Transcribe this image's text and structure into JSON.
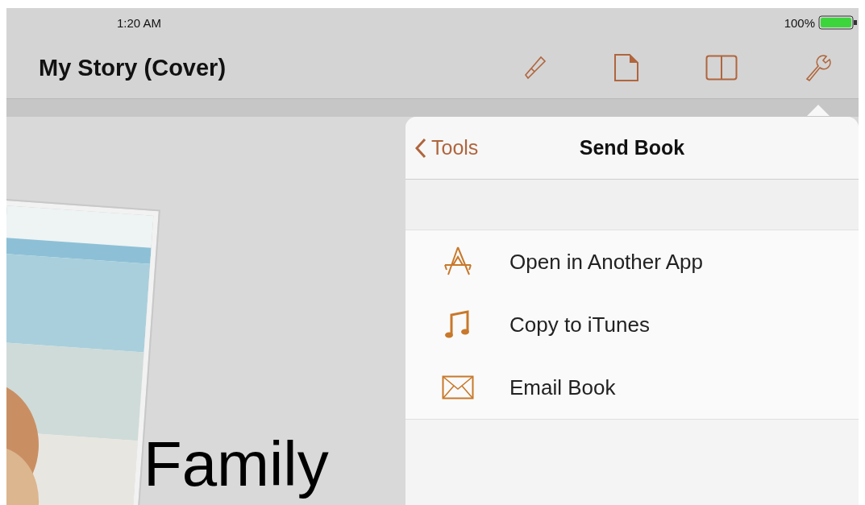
{
  "status_bar": {
    "time": "1:20 AM",
    "battery_percent": "100%"
  },
  "toolbar": {
    "title": "My Story (Cover)",
    "tools": [
      {
        "kind": "pen"
      },
      {
        "kind": "page"
      },
      {
        "kind": "book"
      },
      {
        "kind": "wrench",
        "selected": true
      }
    ]
  },
  "page": {
    "kind": "picture",
    "heading": "Family"
  },
  "popover": {
    "back_label": "Tools",
    "title": "Send Book",
    "items": [
      {
        "kind": "apps",
        "label": "Open in Another App"
      },
      {
        "kind": "music",
        "label": "Copy to iTunes"
      },
      {
        "kind": "mail",
        "label": "Email Book"
      }
    ]
  }
}
